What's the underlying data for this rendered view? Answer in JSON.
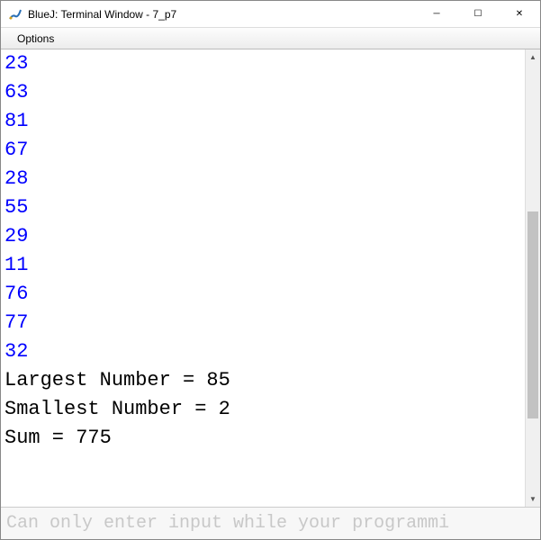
{
  "window": {
    "title": "BlueJ: Terminal Window - 7_p7",
    "controls": {
      "minimize": "─",
      "maximize": "☐",
      "close": "✕"
    }
  },
  "menu": {
    "options": "Options"
  },
  "terminal": {
    "lines": [
      {
        "text": "23",
        "type": "input"
      },
      {
        "text": "63",
        "type": "input"
      },
      {
        "text": "81",
        "type": "input"
      },
      {
        "text": "67",
        "type": "input"
      },
      {
        "text": "28",
        "type": "input"
      },
      {
        "text": "55",
        "type": "input"
      },
      {
        "text": "29",
        "type": "input"
      },
      {
        "text": "11",
        "type": "input"
      },
      {
        "text": "76",
        "type": "input"
      },
      {
        "text": "77",
        "type": "input"
      },
      {
        "text": "32",
        "type": "input"
      },
      {
        "text": "Largest Number = 85",
        "type": "output"
      },
      {
        "text": "Smallest Number = 2",
        "type": "output"
      },
      {
        "text": "Sum = 775",
        "type": "output"
      }
    ]
  },
  "input_hint": "Can only enter input while your programmi"
}
